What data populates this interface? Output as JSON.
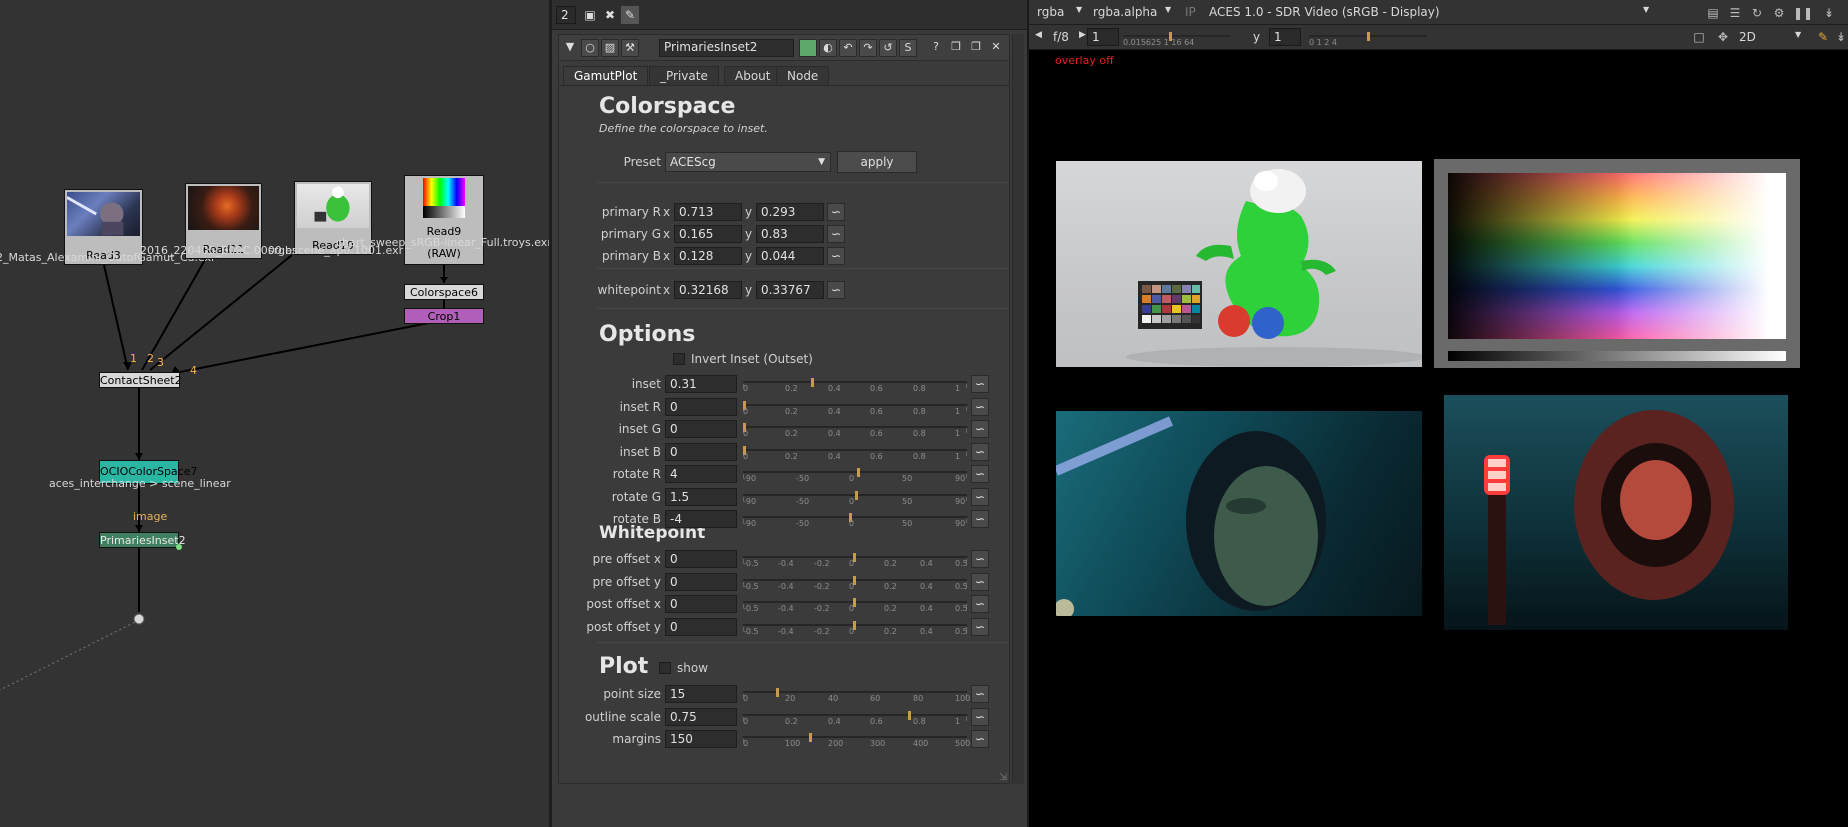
{
  "node_graph": {
    "read_nodes": [
      {
        "label": "Read3",
        "caption": "2_Matas_Alexamini_OutofGamut_Ca.exr"
      },
      {
        "label": "Read11",
        "caption": "2016_220405_B09C.0000.exr"
      },
      {
        "label": "Read10",
        "caption": "srgbscene_ap0.1001.exr"
      },
      {
        "label": "Read9",
        "caption": "chart_sweep_sRGB-linear_Full.troys.exr",
        "caption2": "(RAW)"
      }
    ],
    "colorspace_node": "Colorspace6",
    "crop_node": "Crop1",
    "contactsheet_node": "ContactSheet2",
    "input_numbers": [
      "1",
      "2",
      "3",
      "4"
    ],
    "ocio_node": "OCIOColorSpace7",
    "ocio_caption": "aces_interchange > scene_linear",
    "pipe_label": "image",
    "primaries_node": "PrimariesInset2"
  },
  "properties": {
    "frame_count": "2",
    "node_name": "PrimariesInset2",
    "tabs": [
      "GamutPlot",
      "_Private",
      "About",
      "Node"
    ],
    "colorspace": {
      "title": "Colorspace",
      "subtitle": "Define the colorspace to inset.",
      "preset_label": "Preset",
      "preset_value": "ACEScg",
      "apply_label": "apply",
      "primaries": [
        {
          "label": "primary R",
          "x": "0.713",
          "y": "0.293"
        },
        {
          "label": "primary G",
          "x": "0.165",
          "y": "0.83"
        },
        {
          "label": "primary B",
          "x": "0.128",
          "y": "0.044"
        }
      ],
      "whitepoint": {
        "label": "whitepoint",
        "x": "0.32168",
        "y": "0.33767"
      },
      "x_prefix": "x",
      "y_prefix": "y"
    },
    "options": {
      "title": "Options",
      "invert_label": "Invert Inset (Outset)",
      "rows": [
        {
          "label": "inset",
          "value": "0.31"
        },
        {
          "label": "inset R",
          "value": "0"
        },
        {
          "label": "inset G",
          "value": "0"
        },
        {
          "label": "inset B",
          "value": "0"
        },
        {
          "label": "rotate R",
          "value": "4"
        },
        {
          "label": "rotate G",
          "value": "1.5"
        },
        {
          "label": "rotate B",
          "value": "-4"
        }
      ]
    },
    "whitepoint_section": {
      "title": "Whitepoint",
      "rows": [
        {
          "label": "pre offset x",
          "value": "0"
        },
        {
          "label": "pre offset y",
          "value": "0"
        },
        {
          "label": "post offset x",
          "value": "0"
        },
        {
          "label": "post offset y",
          "value": "0"
        }
      ]
    },
    "plot": {
      "title": "Plot",
      "show_label": "show",
      "rows": [
        {
          "label": "point size",
          "value": "15"
        },
        {
          "label": "outline scale",
          "value": "0.75"
        },
        {
          "label": "margins",
          "value": "150"
        }
      ]
    },
    "slider_ticks": {
      "inset": [
        "0",
        "0.2",
        "0.4",
        "0.6",
        "0.8",
        "1"
      ],
      "rotate": [
        "-90",
        "-50",
        "0",
        "50",
        "90"
      ],
      "offset": [
        "-0.5",
        "-0.4",
        "-0.2",
        "0",
        "0.2",
        "0.4",
        "0.5"
      ],
      "point": [
        "0",
        "20",
        "40",
        "60",
        "80",
        "100"
      ],
      "outline": [
        "0",
        "0.2",
        "0.4",
        "0.6",
        "0.8",
        "1"
      ],
      "margins": [
        "0",
        "100",
        "200",
        "300",
        "400",
        "500"
      ]
    }
  },
  "viewer": {
    "channels": "rgba",
    "alpha": "rgba.alpha",
    "ip": "IP",
    "display": "ACES 1.0 - SDR Video (sRGB - Display)",
    "fstop": "f/8",
    "frame": "1",
    "gain_ticks": "0.015625  1  16  64",
    "y_label": "y",
    "gamma": "1",
    "gamma_ticks": "0  1  2  4",
    "view_mode": "2D",
    "overlay": "overlay off"
  }
}
